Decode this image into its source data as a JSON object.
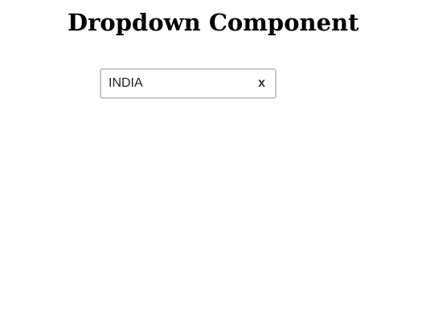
{
  "page": {
    "title": "Dropdown Component"
  },
  "dropdown": {
    "selected_value": "INDIA",
    "clear_label": "x",
    "clear_icon": "close-icon"
  },
  "colors": {
    "background": "#ffffff",
    "title_text": "#000000",
    "field_border": "#c8c8c8",
    "field_text": "#222222",
    "clear_text": "#333333"
  }
}
